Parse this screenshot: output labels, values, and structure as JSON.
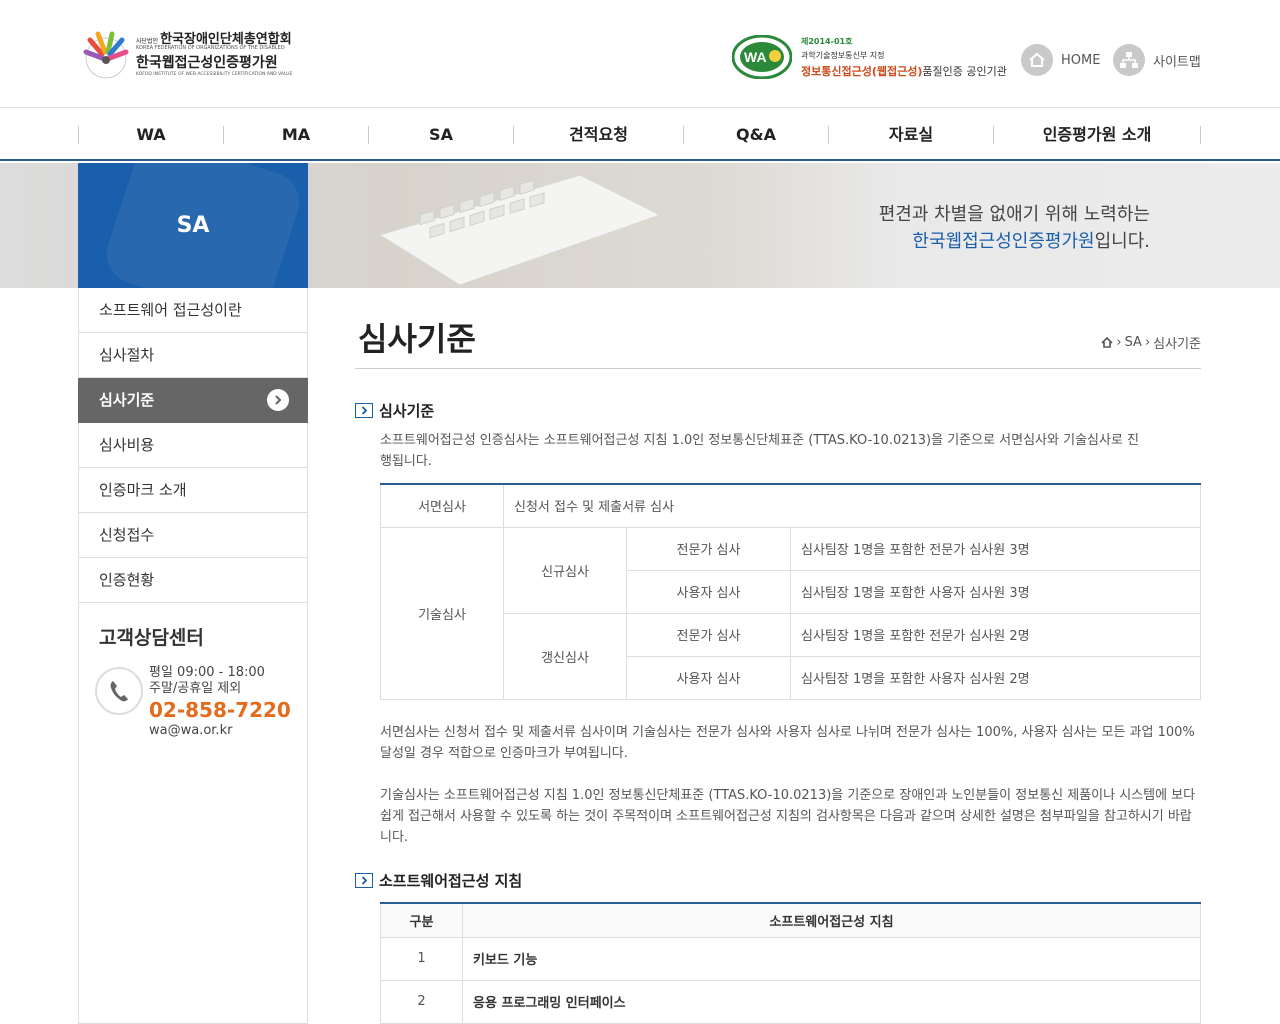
{
  "header": {
    "org_small": "사단법인",
    "org_name": "한국장애인단체총연합회",
    "org_eng": "KOREA FEDERATION OF ORGANIZATIONS OF THE DISABLED",
    "inst_name": "한국웹접근성인증평가원",
    "inst_eng": "KOFOD INSTITUTE OF WEB ACCESSIBILITY CERTIFICATION AND VALUE",
    "cert_no": "제2014-01호",
    "cert_ministry": "과학기술정보통신부 지정",
    "cert_main": "정보통신접근성(웹접근성)",
    "cert_tail": "품질인증 공인기관",
    "home_label": "HOME",
    "sitemap_label": "사이트맵"
  },
  "gnb": [
    "WA",
    "MA",
    "SA",
    "견적요청",
    "Q&A",
    "자료실",
    "인증평가원 소개"
  ],
  "visual": {
    "section": "SA",
    "copy_line1": "편견과 차별을 없애기 위해 노력하는",
    "copy_em": "한국웹접근성인증평가원",
    "copy_tail": "입니다."
  },
  "lnb": {
    "items": [
      "소프트웨어 접근성이란",
      "심사절차",
      "심사기준",
      "심사비용",
      "인증마크 소개",
      "신청접수",
      "인증현황"
    ],
    "active_index": 2
  },
  "cs": {
    "title": "고객상담센터",
    "hours": "평일 09:00 - 18:00",
    "closed": "주말/공휴일 제외",
    "tel": "02-858-7220",
    "email": "wa@wa.or.kr"
  },
  "content": {
    "title": "심사기준",
    "breadcrumb": [
      "SA",
      "심사기준"
    ],
    "sec1": {
      "title": "심사기준",
      "intro": "소프트웨어접근성 인증심사는 소프트웨어접근성 지침 1.0인 정보통신단체표준 (TTAS.KO-10.0213)을 기준으로 서면심사와 기술심사로 진행됩니다.",
      "table": {
        "doc_label": "서면심사",
        "doc_desc": "신청서 접수 및 제출서류 심사",
        "tech_label": "기술심사",
        "new_label": "신규심사",
        "renew_label": "갱신심사",
        "rows": [
          {
            "type": "전문가 심사",
            "desc": "심사팀장 1명을 포함한 전문가 심사원 3명"
          },
          {
            "type": "사용자 심사",
            "desc": "심사팀장 1명을 포함한 사용자 심사원 3명"
          },
          {
            "type": "전문가 심사",
            "desc": "심사팀장 1명을 포함한 전문가 심사원 2명"
          },
          {
            "type": "사용자 심사",
            "desc": "심사팀장 1명을 포함한 사용자 심사원 2명"
          }
        ]
      },
      "para1": "서면심사는 신청서 접수 및 제출서류 심사이며 기술심사는 전문가 심사와 사용자 심사로 나뉘며 전문가 심사는 100%, 사용자 심사는 모든 과업 100% 달성일 경우 적합으로 인증마크가 부여됩니다.",
      "para2": "기술심사는 소프트웨어접근성 지침 1.0인 정보통신단체표준 (TTAS.KO-10.0213)을 기준으로 장애인과 노인분들이 정보통신 제품이나 시스템에 보다 쉽게 접근해서 사용할 수 있도록 하는 것이 주목적이며 소프트웨어접근성 지침의 검사항목은 다음과 같으며 상세한 설명은 첨부파일을 참고하시기 바랍니다."
    },
    "sec2": {
      "title": "소프트웨어접근성 지침",
      "col1": "구분",
      "col2": "소프트웨어접근성 지침",
      "rows": [
        {
          "no": "1",
          "name": "키보드 기능"
        },
        {
          "no": "2",
          "name": "응용 프로그래밍 인터페이스"
        }
      ]
    }
  },
  "colors": {
    "brand_blue": "#1a5fab",
    "nav_line": "#2c5a92",
    "tel_orange": "#e36b1d"
  }
}
